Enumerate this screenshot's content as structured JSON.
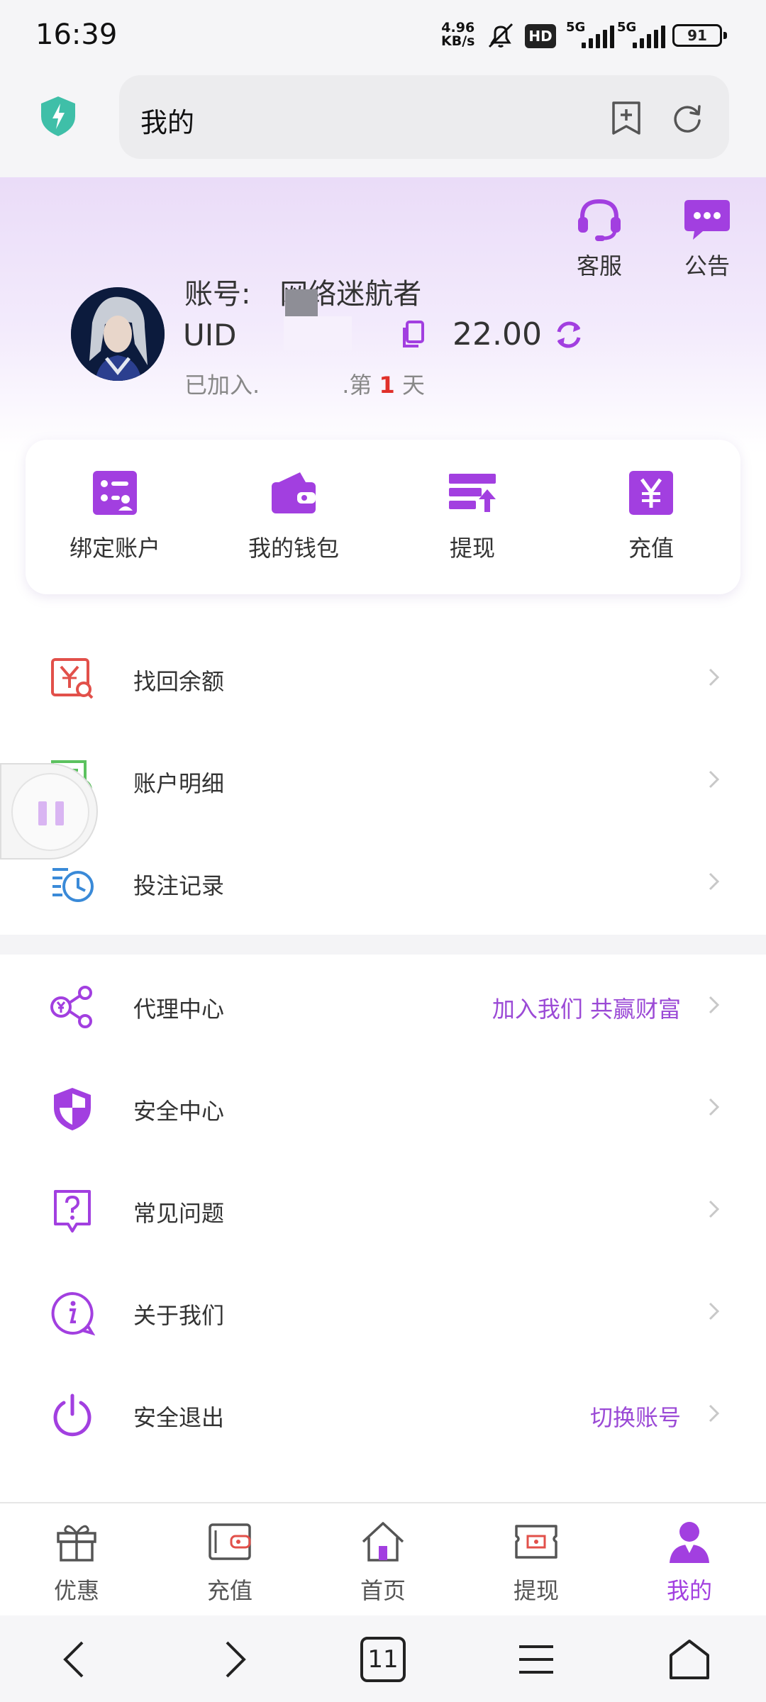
{
  "status_bar": {
    "time": "16:39",
    "net_speed_value": "4.96",
    "net_speed_unit": "KB/s",
    "hd_badge": "HD",
    "signal1_label": "5G",
    "signal2_label": "5G",
    "battery": "91"
  },
  "browser": {
    "url_text": "我的"
  },
  "header": {
    "service_label": "客服",
    "notice_label": "公告",
    "account_prefix": "账号:",
    "account_name": "网络迷航者",
    "uid_label": "UID",
    "balance": "22.00",
    "joined_prefix": "已加入.",
    "joined_mid": ".第",
    "joined_days": "1",
    "joined_suffix": "天"
  },
  "quick_actions": [
    {
      "label": "绑定账户",
      "icon": "bind-account-icon"
    },
    {
      "label": "我的钱包",
      "icon": "wallet-icon"
    },
    {
      "label": "提现",
      "icon": "withdraw-icon"
    },
    {
      "label": "充值",
      "icon": "recharge-yen-icon"
    }
  ],
  "menu_group1": [
    {
      "label": "找回余额",
      "icon": "recover-balance-icon"
    },
    {
      "label": "账户明细",
      "icon": "account-detail-icon"
    },
    {
      "label": "投注记录",
      "icon": "bet-record-icon"
    }
  ],
  "menu_group2": [
    {
      "label": "代理中心",
      "extra": "加入我们 共赢财富",
      "icon": "share-network-icon"
    },
    {
      "label": "安全中心",
      "extra": "",
      "icon": "shield-icon"
    },
    {
      "label": "常见问题",
      "extra": "",
      "icon": "question-icon"
    },
    {
      "label": "关于我们",
      "extra": "",
      "icon": "info-icon"
    },
    {
      "label": "安全退出",
      "extra": "切换账号",
      "icon": "power-icon"
    }
  ],
  "tabbar": [
    {
      "label": "优惠",
      "icon": "gift-icon",
      "active": false
    },
    {
      "label": "充值",
      "icon": "wallet-icon",
      "active": false
    },
    {
      "label": "首页",
      "icon": "home-icon",
      "active": false
    },
    {
      "label": "提现",
      "icon": "ticket-icon",
      "active": false
    },
    {
      "label": "我的",
      "icon": "person-icon",
      "active": true
    }
  ],
  "system_nav": {
    "tab_count": "11"
  },
  "colors": {
    "accent": "#a23fe0",
    "accent_text": "#9b4ad6",
    "highlight_red": "#e0302a"
  }
}
